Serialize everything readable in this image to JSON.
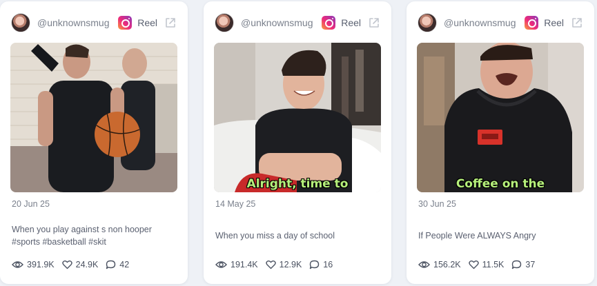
{
  "cards": [
    {
      "username": "@unknownsmug",
      "platform": "Reel",
      "date": "20 Jun 25",
      "description": "When you play against s non hooper #sports #basketball #skit",
      "overlay_caption": "",
      "views": "391.9K",
      "likes": "24.9K",
      "comments": "42"
    },
    {
      "username": "@unknownsmug",
      "platform": "Reel",
      "date": "14 May 25",
      "description": "When you miss a day of school",
      "overlay_caption": "Alright, time to",
      "views": "191.4K",
      "likes": "12.9K",
      "comments": "16"
    },
    {
      "username": "@unknownsmug",
      "platform": "Reel",
      "date": "30 Jun 25",
      "description": "If People Were ALWAYS Angry",
      "overlay_caption": "Coffee on the",
      "views": "156.2K",
      "likes": "11.5K",
      "comments": "37"
    }
  ],
  "icons": {
    "platform": "instagram-icon",
    "open": "external-link-icon",
    "views": "eye-icon",
    "likes": "heart-icon",
    "comments": "comment-icon"
  },
  "colors": {
    "background": "#eef1f6",
    "card": "#ffffff",
    "caption_overlay": "#b6f07b"
  }
}
